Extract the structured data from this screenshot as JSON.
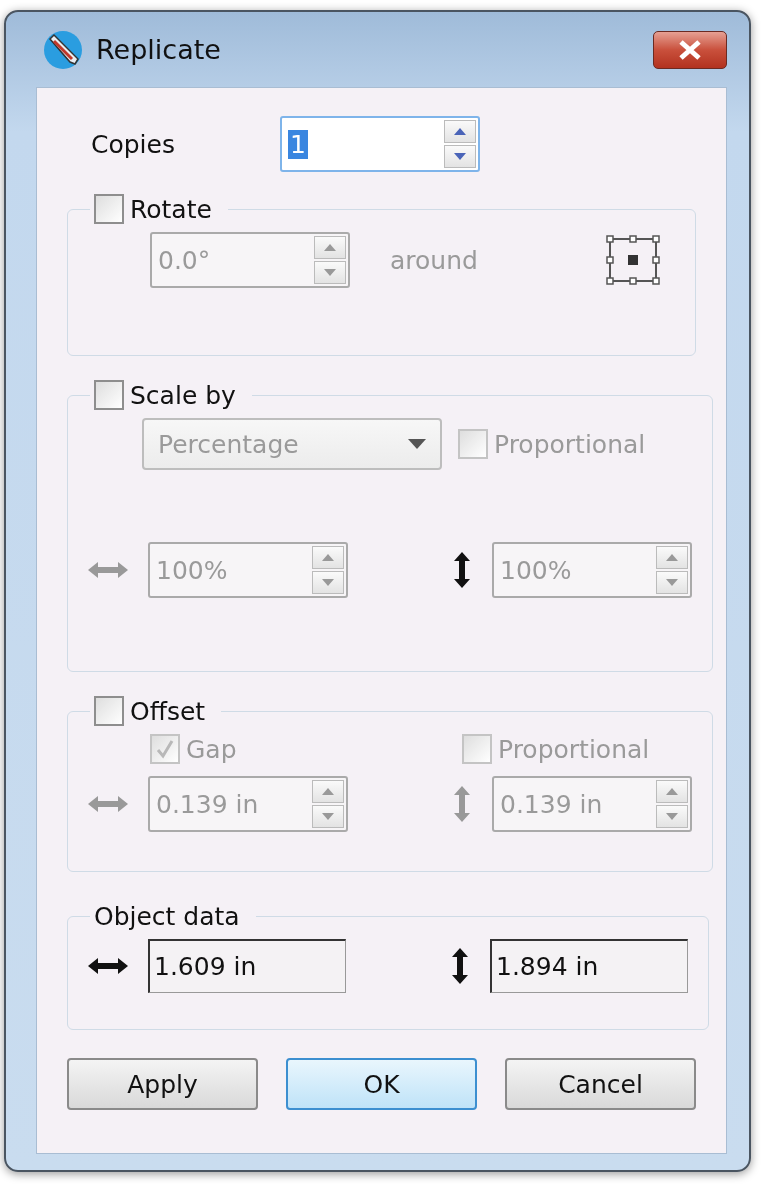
{
  "window": {
    "title": "Replicate"
  },
  "copies": {
    "label": "Copies",
    "value": "1"
  },
  "rotate": {
    "label": "Rotate",
    "checked": false,
    "angle": "0.0°",
    "around_label": "around"
  },
  "scale": {
    "label": "Scale by",
    "checked": false,
    "mode": "Percentage",
    "proportional": {
      "label": "Proportional",
      "checked": false
    },
    "horizontal": "100%",
    "vertical": "100%"
  },
  "offset": {
    "label": "Offset",
    "checked": false,
    "gap": {
      "label": "Gap",
      "checked": true
    },
    "proportional": {
      "label": "Proportional",
      "checked": false
    },
    "horizontal": "0.139 in",
    "vertical": "0.139 in"
  },
  "object_data": {
    "label": "Object data",
    "horizontal": "1.609 in",
    "vertical": "1.894 in"
  },
  "buttons": [
    {
      "label": "Apply",
      "selected": false
    },
    {
      "label": "OK",
      "selected": true
    },
    {
      "label": "Cancel",
      "selected": false
    }
  ]
}
